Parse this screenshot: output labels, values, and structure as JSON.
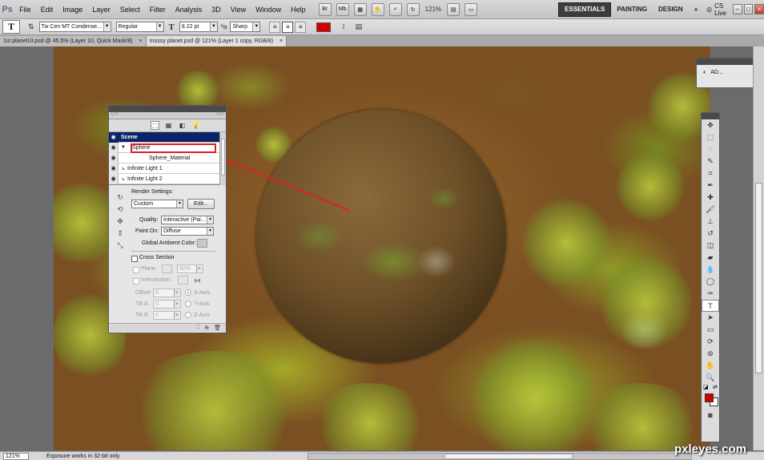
{
  "app": {
    "logo": "Ps",
    "zoom": "121%"
  },
  "menu": [
    "File",
    "Edit",
    "Image",
    "Layer",
    "Select",
    "Filter",
    "Analysis",
    "3D",
    "View",
    "Window",
    "Help"
  ],
  "menubar_buttons": {
    "br": "Br",
    "mb": "Mb"
  },
  "workspaces": {
    "essentials": "ESSENTIALS",
    "painting": "PAINTING",
    "design": "DESIGN",
    "more": "»",
    "cs_live": "CS Live"
  },
  "window_controls": {
    "minimize": "–",
    "restore": "□",
    "close": "×"
  },
  "options": {
    "tool_glyph": "T",
    "font_family": "Tw Cen MT Condense...",
    "font_style": "Regular",
    "font_size": "8.22 pt",
    "antialias": "Sharp",
    "size_glyph": "T",
    "color_hex": "#d40000"
  },
  "tabs": [
    {
      "label": "1st planetUI.psd @ 45.5% (Layer 10, Quick Mask/8)",
      "close": "×"
    },
    {
      "label": "mossy planet.psd @ 121% (Layer 1 copy, RGB/8)",
      "close": "×"
    }
  ],
  "panel3d": {
    "tabs": {
      "left": "CH",
      "right": "CH"
    },
    "scene": {
      "header": "Scene",
      "rows": [
        {
          "label": "Sphere"
        },
        {
          "label": "Sphere_Material"
        },
        {
          "label": "Infinite Light 1"
        },
        {
          "label": "Infinite Light 2"
        }
      ]
    },
    "render_settings_label": "Render Settings:",
    "render_preset": "Custom",
    "edit_button": "Edit...",
    "quality_label": "Quality:",
    "quality_value": "Interactive (Pai...",
    "paint_on_label": "Paint On:",
    "paint_on_value": "Diffuse",
    "ambient_label": "Global Ambient Color:",
    "cross_section_label": "Cross Section",
    "plane_label": "Plane:",
    "plane_value": "50%",
    "intersection_label": "Intersection:",
    "offset_label": "Offset:",
    "tilt_a_label": "Tilt A:",
    "tilt_b_label": "Tilt B:",
    "field_zero": "0",
    "x_axis": "X-Axis",
    "y_axis": "Y-Axis",
    "z_axis": "Z-Axis"
  },
  "adjustments_panel": {
    "label": "AD..."
  },
  "status": {
    "zoom": "121%",
    "message": "Exposure works in 32-bit only"
  },
  "watermark": "pxleyes.com"
}
